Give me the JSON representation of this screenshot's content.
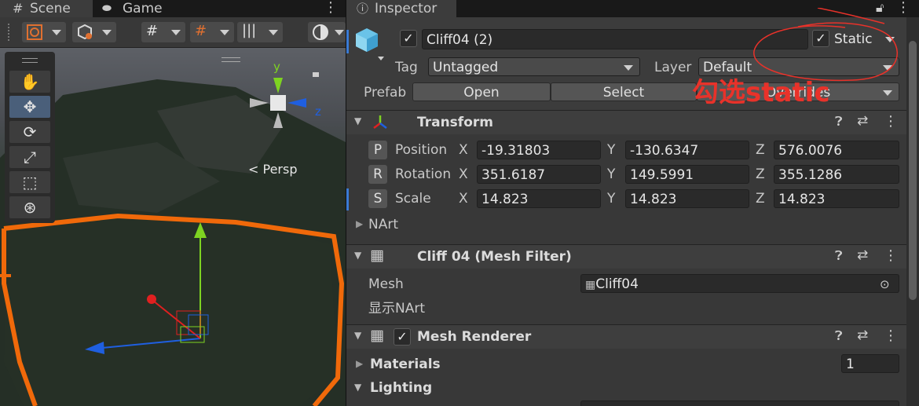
{
  "scene_tabs": {
    "scene_label": "Scene",
    "game_label": "Game",
    "scene_icon": "grid-hash-icon",
    "game_icon": "gamepad-icon",
    "menu_icon": "kebab-menu-icon"
  },
  "scene_toolbar": {
    "buttons": [
      "draw-mode-button",
      "shading-mode-button",
      "grid-snap-button",
      "increment-snap-button",
      "render-grid-button",
      "gizmo-orientation-button"
    ]
  },
  "tools": {
    "items": [
      "hand-tool",
      "move-tool",
      "rotate-tool",
      "scale-tool",
      "rect-tool",
      "transform-tool"
    ]
  },
  "viewport": {
    "persp_label": "< Persp",
    "gizmo_y": "y",
    "gizmo_z": "z"
  },
  "inspector": {
    "tab_label": "Inspector",
    "tab_icon": "info-icon",
    "lock_icon": "lock-icon",
    "object_name": "Cliff04 (2)",
    "static_label": "Static",
    "tag_label": "Tag",
    "tag_value": "Untagged",
    "layer_label": "Layer",
    "layer_value": "Default",
    "prefab_label": "Prefab",
    "open_label": "Open",
    "select_label": "Select",
    "overrides_label": "Overrides",
    "annotation_text": "勾选static",
    "annotation_color": "#e8322a"
  },
  "transform": {
    "title": "Transform",
    "rows": [
      {
        "badge": "P",
        "label": "Position",
        "x": "-19.31803",
        "y": "-130.6347",
        "z": "576.0076"
      },
      {
        "badge": "R",
        "label": "Rotation",
        "x": "351.6187",
        "y": "149.5991",
        "z": "355.1286"
      },
      {
        "badge": "S",
        "label": "Scale",
        "x": "14.823",
        "y": "14.823",
        "z": "14.823"
      }
    ],
    "axis_x": "X",
    "axis_y": "Y",
    "axis_z": "Z",
    "nart_label": "NArt"
  },
  "mesh_filter": {
    "title": "Cliff 04 (Mesh Filter)",
    "mesh_label": "Mesh",
    "mesh_value": "Cliff04",
    "note": "显示NArt"
  },
  "mesh_renderer": {
    "title": "Mesh Renderer",
    "materials_label": "Materials",
    "materials_count": "1",
    "lighting_label": "Lighting"
  },
  "colors": {
    "selection_outline": "#f0690a",
    "gizmo_y": "#7ed321",
    "gizmo_x": "#e02020",
    "gizmo_z": "#1f5fe0"
  }
}
